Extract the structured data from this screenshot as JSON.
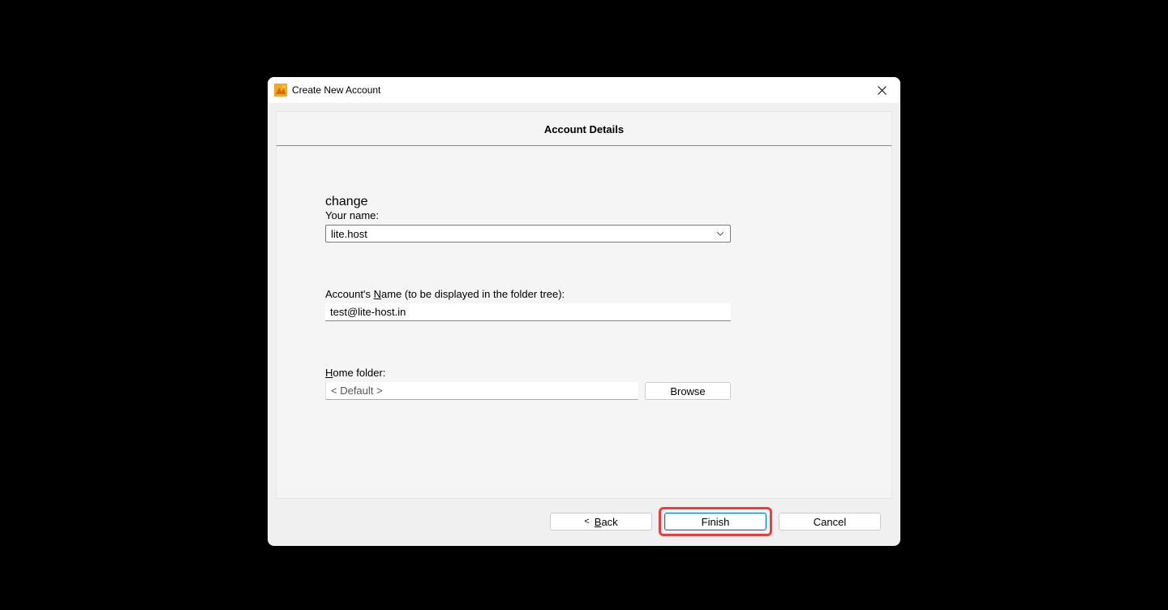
{
  "dialog": {
    "title": "Create New Account",
    "section_title": "Account Details",
    "fields": {
      "your_name": {
        "label": "Your name:",
        "value": "lite.host"
      },
      "account_name": {
        "label_pre": "Account's ",
        "label_u": "N",
        "label_post": "ame (to be displayed in the folder tree):",
        "value": "test@lite-host.in"
      },
      "home_folder": {
        "label_u": "H",
        "label_post": "ome folder:",
        "value": "< Default >",
        "browse": "Browse"
      }
    },
    "buttons": {
      "back_arrow": "<",
      "back_u": "B",
      "back_post": "ack",
      "finish_u": "F",
      "finish_post": "inish",
      "cancel": "Cancel"
    }
  }
}
